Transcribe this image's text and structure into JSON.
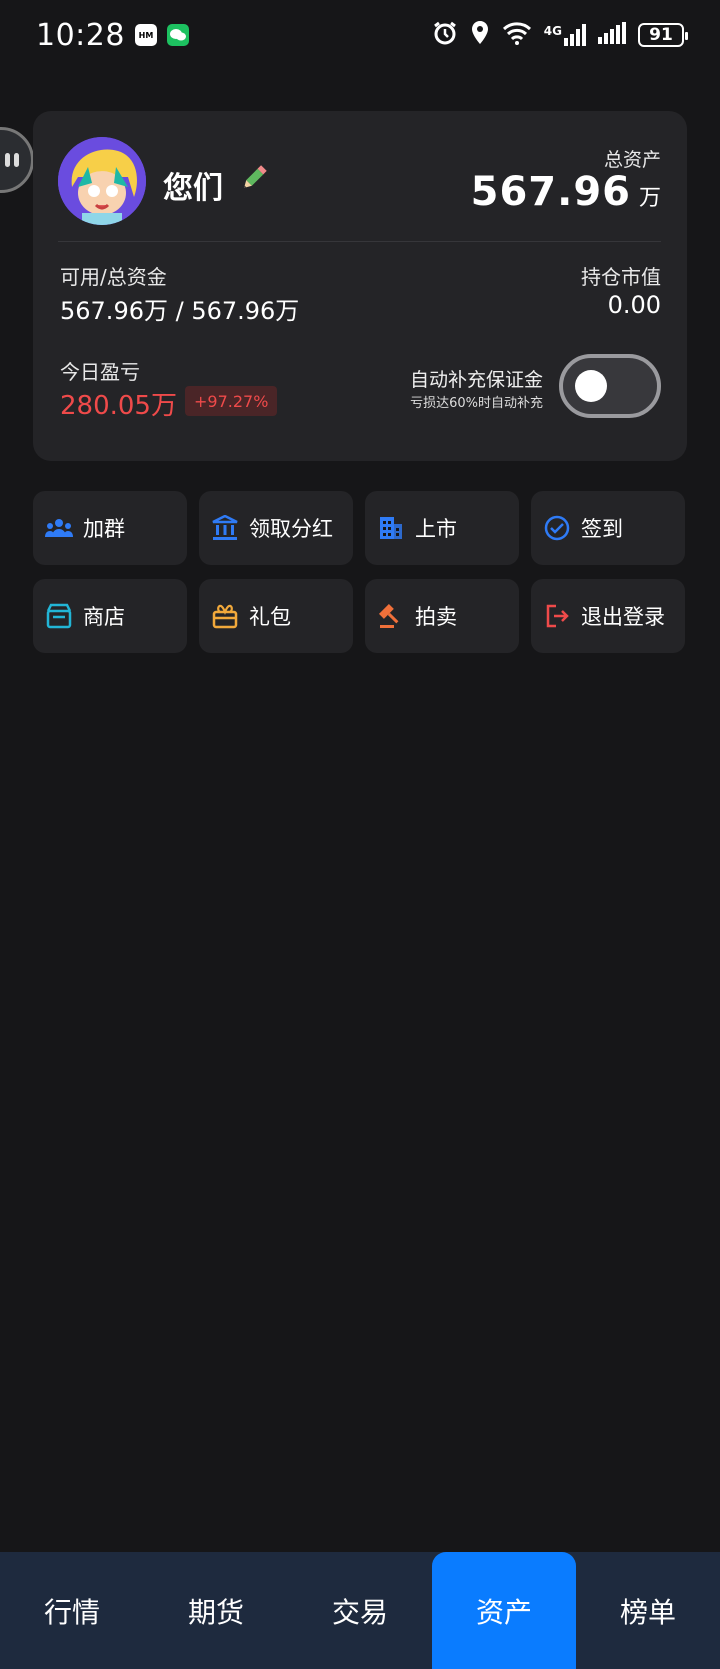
{
  "status_bar": {
    "time": "10:28",
    "battery": "91",
    "network": "4G"
  },
  "account": {
    "name": "您们",
    "total_assets_label": "总资产",
    "total_assets_value": "567.96",
    "total_assets_unit": "万",
    "available_label": "可用/总资金",
    "available_value": "567.96万 / 567.96万",
    "position_label": "持仓市值",
    "position_value": "0.00",
    "pnl_label": "今日盈亏",
    "pnl_value": "280.05万",
    "pnl_percent": "+97.27%",
    "auto_margin_label": "自动补充保证金",
    "auto_margin_sub": "亏损达60%时自动补充",
    "auto_margin_enabled": false
  },
  "actions": [
    {
      "label": "加群",
      "icon": "group-icon",
      "color": "#2f7bf6"
    },
    {
      "label": "领取分红",
      "icon": "bank-icon",
      "color": "#2f7bf6"
    },
    {
      "label": "上市",
      "icon": "building-icon",
      "color": "#2f7bf6"
    },
    {
      "label": "签到",
      "icon": "check-circle-icon",
      "color": "#2f7bf6"
    },
    {
      "label": "商店",
      "icon": "store-icon",
      "color": "#22b5d6"
    },
    {
      "label": "礼包",
      "icon": "gift-icon",
      "color": "#f2a93b"
    },
    {
      "label": "拍卖",
      "icon": "gavel-icon",
      "color": "#f0703a"
    },
    {
      "label": "退出登录",
      "icon": "logout-icon",
      "color": "#ef4a4a"
    }
  ],
  "nav": [
    {
      "label": "行情"
    },
    {
      "label": "期货"
    },
    {
      "label": "交易"
    },
    {
      "label": "资产"
    },
    {
      "label": "榜单"
    }
  ],
  "nav_active": "资产",
  "colors": {
    "background": "#161618",
    "card": "#242427",
    "accent": "#0a7cff",
    "loss": "#ef4a4a"
  }
}
